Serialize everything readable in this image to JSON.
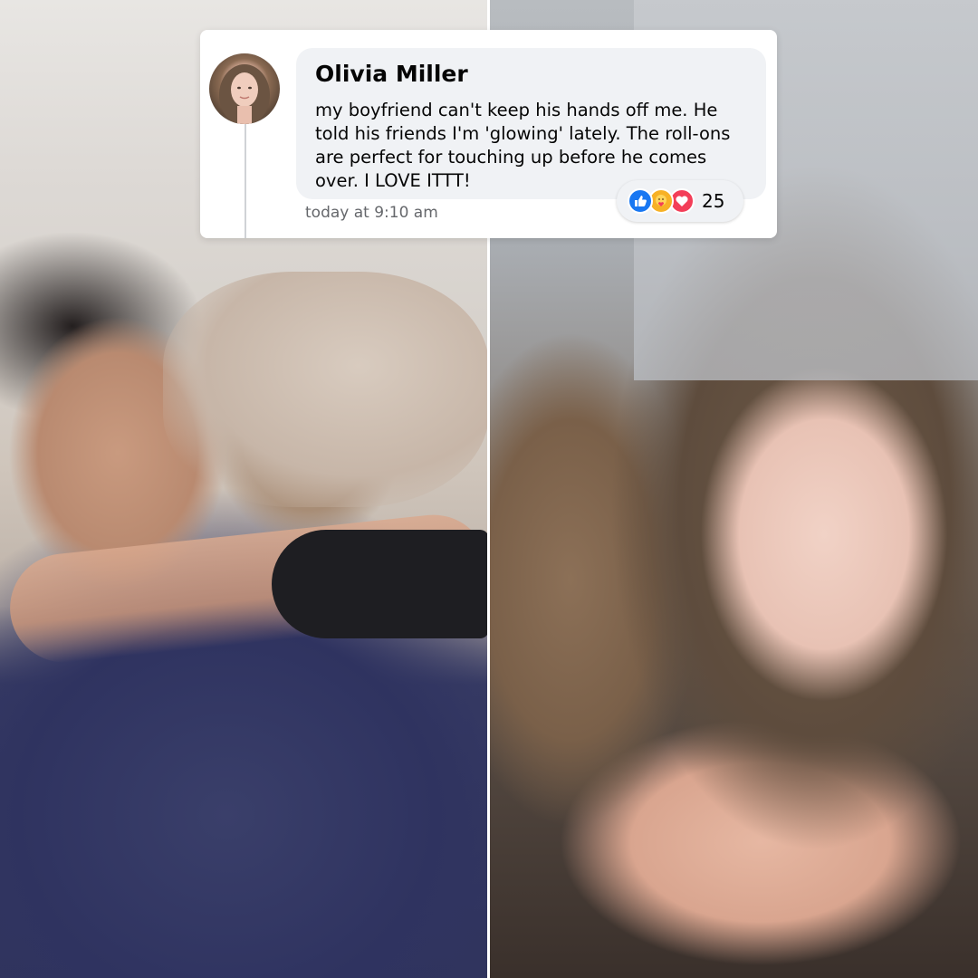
{
  "comment": {
    "author": "Olivia Miller",
    "text": "my boyfriend can't keep his hands off me. He told his friends I'm 'glowing' lately. The roll-ons are perfect for touching up before he comes over. I LOVE ITTT!",
    "timestamp": "today at 9:10 am",
    "reactions": {
      "icons": [
        "like-icon",
        "care-icon",
        "love-icon"
      ],
      "count": "25"
    }
  },
  "colors": {
    "like": "#1877f2",
    "care": "#f7b125",
    "love": "#f33e58",
    "bubble": "#f0f2f5",
    "timestamp": "#65676b"
  }
}
